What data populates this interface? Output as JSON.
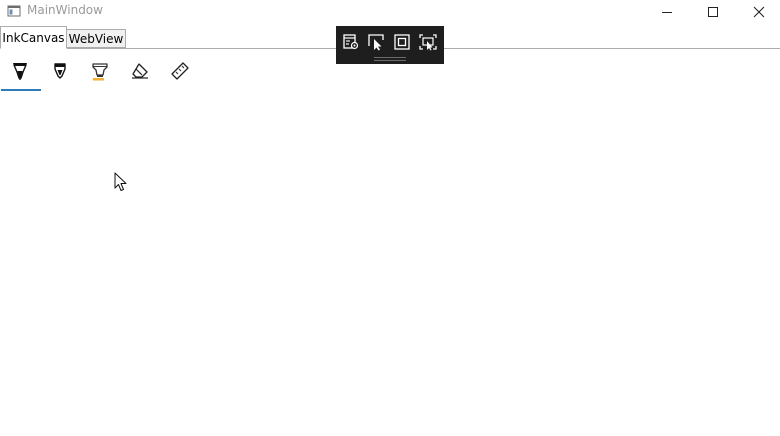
{
  "window": {
    "title": "MainWindow",
    "controls": {
      "minimize": "minimize-icon",
      "maximize": "maximize-icon",
      "close": "close-icon"
    }
  },
  "tabs": [
    {
      "label": "InkCanvas",
      "selected": true
    },
    {
      "label": "WebView",
      "selected": false
    }
  ],
  "ink_toolbar": {
    "tools": [
      {
        "icon": "ballpoint-pen-icon",
        "selected": true
      },
      {
        "icon": "pencil-icon",
        "selected": false
      },
      {
        "icon": "highlighter-icon",
        "selected": false
      },
      {
        "icon": "eraser-icon",
        "selected": false
      },
      {
        "icon": "ruler-icon",
        "selected": false
      }
    ],
    "accent": "#2f7ab8",
    "highlighter_color": "#f2b035"
  },
  "debug_toolbar": {
    "buttons": [
      {
        "icon": "live-visual-tree-icon"
      },
      {
        "icon": "select-element-icon"
      },
      {
        "icon": "display-layout-adorners-icon"
      },
      {
        "icon": "track-focus-icon"
      }
    ],
    "background": "#1e1e1e"
  }
}
